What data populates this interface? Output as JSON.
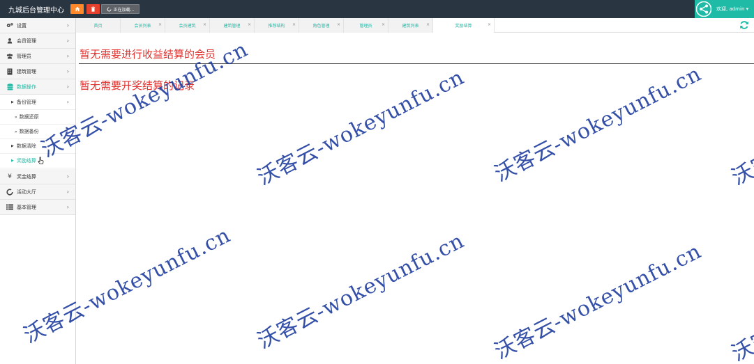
{
  "header": {
    "brand": "九城后台管理中心",
    "loading_label": "正在加载...",
    "welcome": "欢迎, admin ▾"
  },
  "sidebar": {
    "items": [
      {
        "label": "设置",
        "icon": "gears-icon"
      },
      {
        "label": "会员管理",
        "icon": "user-icon"
      },
      {
        "label": "管理员",
        "icon": "users-icon"
      },
      {
        "label": "建筑管理",
        "icon": "building-icon"
      },
      {
        "label": "数据操作",
        "icon": "database-icon"
      }
    ],
    "sub_items": [
      {
        "label": "备份管理"
      },
      {
        "label": "数据还原"
      },
      {
        "label": "数据备份"
      },
      {
        "label": "数据清除"
      },
      {
        "label": "奖励结算"
      }
    ],
    "bottom_items": [
      {
        "label": "奖金结算",
        "icon": "yen-icon"
      },
      {
        "label": "活动大厅",
        "icon": "circle-icon"
      },
      {
        "label": "基本管理",
        "icon": "list-icon"
      }
    ]
  },
  "tabs": [
    {
      "label": "首页"
    },
    {
      "label": "会员列表"
    },
    {
      "label": "会员建筑"
    },
    {
      "label": "建筑管理"
    },
    {
      "label": "推荐结构"
    },
    {
      "label": "角色管理"
    },
    {
      "label": "管理员"
    },
    {
      "label": "建筑列表"
    },
    {
      "label": "奖励结算"
    }
  ],
  "content": {
    "message_1": "暂无需要进行收益结算的会员",
    "message_2": "暂无需要开奖结算的记录"
  },
  "watermark": "沃客云-wokeyunfu.cn",
  "colors": {
    "navbar": "#2a3542",
    "accent": "#1fbba6",
    "message": "#e4302c",
    "home_button": "#ff892a",
    "trash_button": "#e5412d",
    "watermark": "#1f3d9e"
  }
}
